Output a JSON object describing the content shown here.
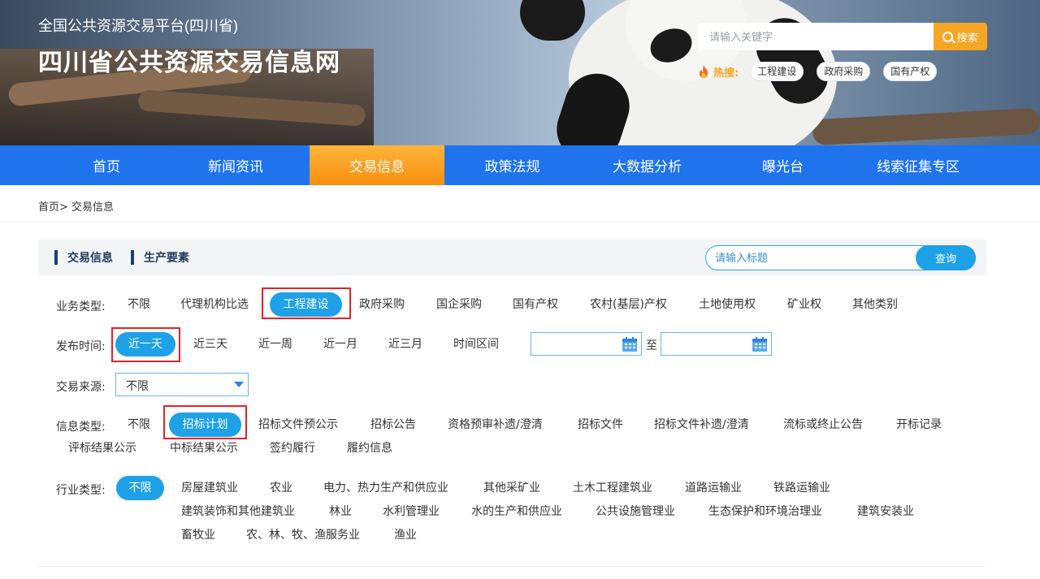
{
  "site": {
    "subtitle": "全国公共资源交易平台(四川省)",
    "title": "四川省公共资源交易信息网"
  },
  "search": {
    "placeholder": "请输入关键字",
    "button": "搜索"
  },
  "hot": {
    "label": "热搜:",
    "tags": [
      "工程建设",
      "政府采购",
      "国有产权"
    ]
  },
  "nav": {
    "items": [
      "首页",
      "新闻资讯",
      "交易信息",
      "政策法规",
      "大数据分析",
      "曝光台",
      "线索征集专区"
    ],
    "active_index": 2
  },
  "breadcrumb": "首页> 交易信息",
  "panel": {
    "tabs": [
      "交易信息",
      "生产要素"
    ],
    "title_search_placeholder": "请输入标题",
    "title_search_button": "查询"
  },
  "filters": {
    "business_type": {
      "label": "业务类型:",
      "options": [
        "不限",
        "代理机构比选",
        "工程建设",
        "政府采购",
        "国企采购",
        "国有产权",
        "农村(基层)产权",
        "土地使用权",
        "矿业权",
        "其他类别"
      ],
      "selected": "工程建设"
    },
    "publish_time": {
      "label": "发布时间:",
      "options": [
        "近一天",
        "近三天",
        "近一周",
        "近一月",
        "近三月",
        "时间区间"
      ],
      "selected": "近一天",
      "range_separator": "至",
      "start_date": "",
      "end_date": ""
    },
    "source": {
      "label": "交易来源:",
      "selected": "不限"
    },
    "info_type": {
      "label": "信息类型:",
      "options": [
        "不限",
        "招标计划",
        "招标文件预公示",
        "招标公告",
        "资格预审补遗/澄清",
        "招标文件",
        "招标文件补遗/澄清",
        "流标或终止公告",
        "开标记录",
        "评标结果公示",
        "中标结果公示",
        "签约履行",
        "履约信息"
      ],
      "selected": "招标计划"
    },
    "industry_type": {
      "label": "行业类型:",
      "options": [
        "不限",
        "房屋建筑业",
        "农业",
        "电力、热力生产和供应业",
        "其他采矿业",
        "土木工程建筑业",
        "道路运输业",
        "铁路运输业",
        "建筑装饰和其他建筑业",
        "林业",
        "水利管理业",
        "水的生产和供应业",
        "公共设施管理业",
        "生态保护和环境治理业",
        "建筑安装业",
        "畜牧业",
        "农、林、牧、渔服务业",
        "渔业"
      ],
      "selected": "不限"
    }
  },
  "colors": {
    "nav_blue": "#1f74ed",
    "nav_active_orange": "#f78f0f",
    "selected_blue": "#1ea1e6",
    "highlight_red": "#e8202a",
    "search_orange": "#f5a623"
  }
}
